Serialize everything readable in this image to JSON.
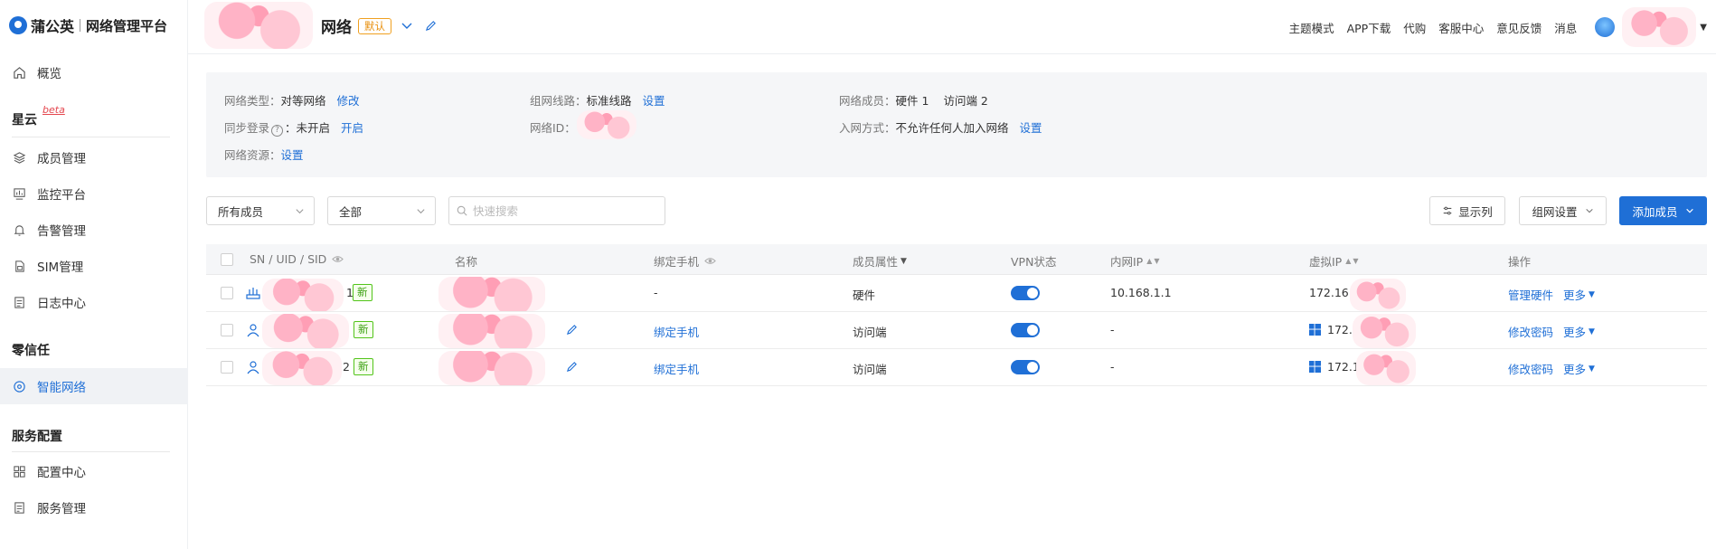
{
  "brand": {
    "name": "蒲公英",
    "subtitle": "网络管理平台"
  },
  "sidebar": {
    "overview": "概览",
    "sections": [
      {
        "title": "星云",
        "badge": "beta",
        "items": [
          "成员管理",
          "监控平台",
          "告警管理",
          "SIM管理",
          "日志中心"
        ]
      },
      {
        "title": "零信任",
        "items": [
          "智能网络"
        ]
      },
      {
        "title": "服务配置",
        "items": [
          "配置中心",
          "服务管理"
        ]
      }
    ],
    "active": "智能网络"
  },
  "header": {
    "network_name": "网络",
    "default_badge": "默认",
    "topnav": [
      "主题模式",
      "APP下载",
      "代购",
      "客服中心",
      "意见反馈",
      "消息"
    ]
  },
  "info": {
    "net_type_label": "网络类型：",
    "net_type_value": "对等网络",
    "net_type_action": "修改",
    "line_label": "组网线路：",
    "line_value": "标准线路",
    "line_action": "设置",
    "members_label": "网络成员：",
    "members_hw": "硬件 1",
    "members_client": "访问端 2",
    "sso_label": "同步登录",
    "sso_value": "：未开启",
    "sso_action": "开启",
    "net_id_label": "网络ID：",
    "join_label": "入网方式：",
    "join_value": "不允许任何人加入网络",
    "join_action": "设置",
    "resource_label": "网络资源：",
    "resource_action": "设置"
  },
  "filters": {
    "member_select": "所有成员",
    "status_select": "全部",
    "search_placeholder": "快速搜索",
    "columns_button": "显示列",
    "network_settings_button": "组网设置",
    "add_member_button": "添加成员"
  },
  "table": {
    "headers": {
      "sn": "SN / UID / SID",
      "name": "名称",
      "phone": "绑定手机",
      "attr": "成员属性",
      "vpn": "VPN状态",
      "lan_ip": "内网IP",
      "virtual_ip": "虚拟IP",
      "action": "操作"
    },
    "rows": [
      {
        "sn_tail": "1",
        "new": "新",
        "phone": "-",
        "attr": "硬件",
        "vpn_on": true,
        "lan_ip": "10.168.1.1",
        "virtual_ip": "172.16.",
        "action": "管理硬件",
        "more": "更多",
        "type": "hardware"
      },
      {
        "sn_tail": "",
        "new": "新",
        "phone": "绑定手机",
        "attr": "访问端",
        "vpn_on": true,
        "lan_ip": "-",
        "virtual_ip": "172.",
        "action": "修改密码",
        "more": "更多",
        "type": "client"
      },
      {
        "sn_tail": "2",
        "new": "新",
        "phone": "绑定手机",
        "attr": "访问端",
        "vpn_on": true,
        "lan_ip": "-",
        "virtual_ip": "172.1",
        "action": "修改密码",
        "more": "更多",
        "type": "client"
      }
    ]
  },
  "colors": {
    "primary": "#1f6fd6",
    "badge_orange": "#e8900e",
    "new_green": "#389e0d"
  }
}
